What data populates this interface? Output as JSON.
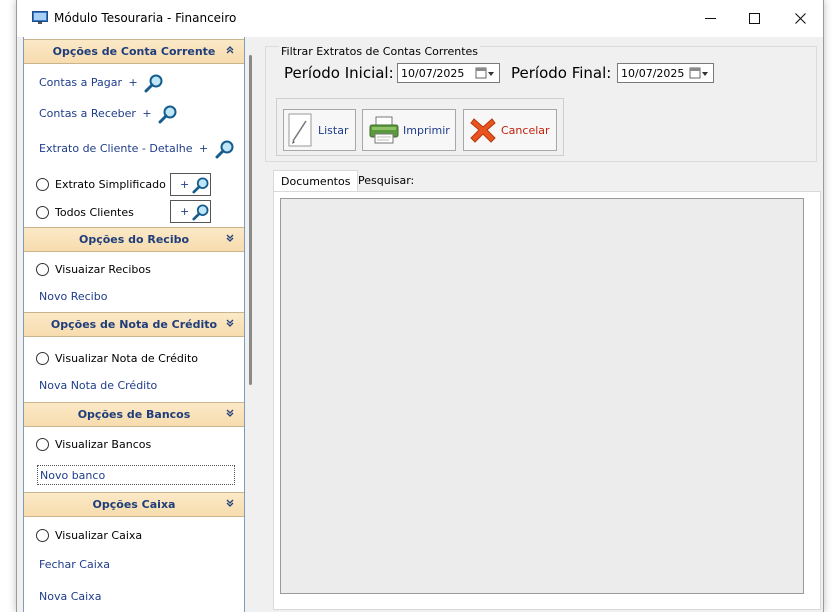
{
  "window": {
    "title": "Módulo Tesouraria - Financeiro",
    "minimize": "—",
    "maximize": "☐",
    "close": "✕"
  },
  "sidebar": {
    "conta_corrente": {
      "header": "Opções de Conta Corrente",
      "chevron": "⌃⌃",
      "contas_pagar": "Contas a Pagar",
      "contas_receber": "Contas a Receber",
      "extrato_cliente": "Extrato de Cliente - Detalhe",
      "plus": "+",
      "extrato_simplificado": "Extrato Simplificado",
      "todos_clientes": "Todos Clientes"
    },
    "recibo": {
      "header": "Opções do Recibo",
      "chevron": "⌄⌄",
      "visualizar": "Visuaizar Recibos",
      "novo": "Novo Recibo"
    },
    "nota_credito": {
      "header": "Opções de Nota de Crédito",
      "chevron": "⌄⌄",
      "visualizar": "Visualizar Nota de Crédito",
      "nova": "Nova Nota de Crédito"
    },
    "bancos": {
      "header": "Opções de Bancos",
      "chevron": "⌄⌄",
      "visualizar": "Visualizar Bancos",
      "novo": "Novo banco"
    },
    "caixa": {
      "header": "Opções Caixa",
      "chevron": "⌄⌄",
      "visualizar": "Visualizar Caixa",
      "fechar": "Fechar Caixa",
      "nova": "Nova Caixa"
    }
  },
  "filter": {
    "group_title": "Filtrar Extratos de Contas Correntes",
    "periodo_inicial_label": "Período Inicial:",
    "periodo_inicial_value": "10/07/2025",
    "periodo_final_label": "Período Final:",
    "periodo_final_value": "10/07/2025"
  },
  "actions": {
    "listar": "Listar",
    "imprimir": "Imprimir",
    "cancelar": "Cancelar"
  },
  "tabs": {
    "documentos": "Documentos",
    "pesquisar": "Pesquisar:"
  },
  "colors": {
    "section_header_bg": "#f8e2b8",
    "link_text": "#1f3d8a",
    "cancel_x": "#e8531f"
  }
}
